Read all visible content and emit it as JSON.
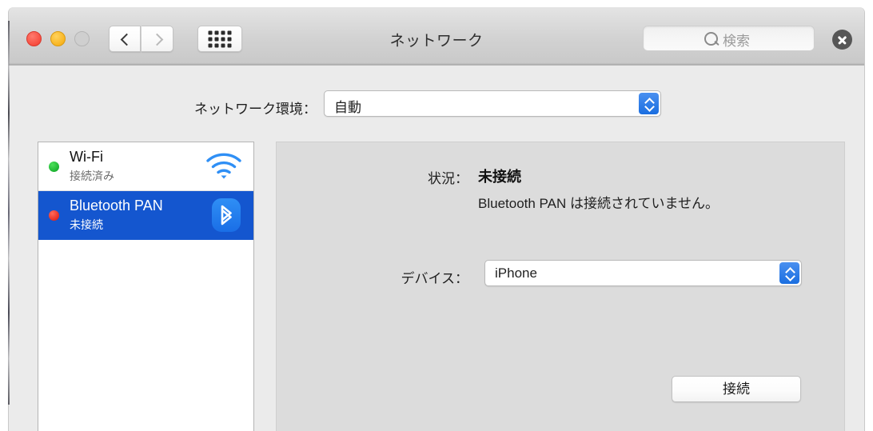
{
  "window": {
    "title": "ネットワーク"
  },
  "toolbar": {
    "back_icon": "chevron-left-icon",
    "forward_icon": "chevron-right-icon",
    "showall_icon": "grid-dots-icon",
    "traffic_lights": [
      "close",
      "minimize",
      "zoom"
    ]
  },
  "search": {
    "placeholder": "検索",
    "value": "",
    "icon": "search-icon",
    "clear_icon": "clear-circle-icon"
  },
  "location": {
    "label": "ネットワーク環境：",
    "value": "自動",
    "options": [
      "自動"
    ]
  },
  "services": [
    {
      "name": "Wi-Fi",
      "state": "接続済み",
      "status_color": "#16ad2c",
      "icon": "wifi-icon",
      "selected": false
    },
    {
      "name": "Bluetooth PAN",
      "state": "未接続",
      "status_color": "#e4231a",
      "icon": "bluetooth-icon",
      "selected": true
    }
  ],
  "detail": {
    "status_label": "状況：",
    "status_value": "未接続",
    "status_detail": "Bluetooth PAN は接続されていません。",
    "device_label": "デバイス：",
    "device_value": "iPhone",
    "device_options": [
      "iPhone"
    ],
    "connect_label": "接続"
  },
  "colors": {
    "selection_blue": "#1456cf",
    "popup_arrow_blue": "#1a6ee0",
    "window_bg": "#ebebeb",
    "detail_bg": "#dcdcdc"
  }
}
